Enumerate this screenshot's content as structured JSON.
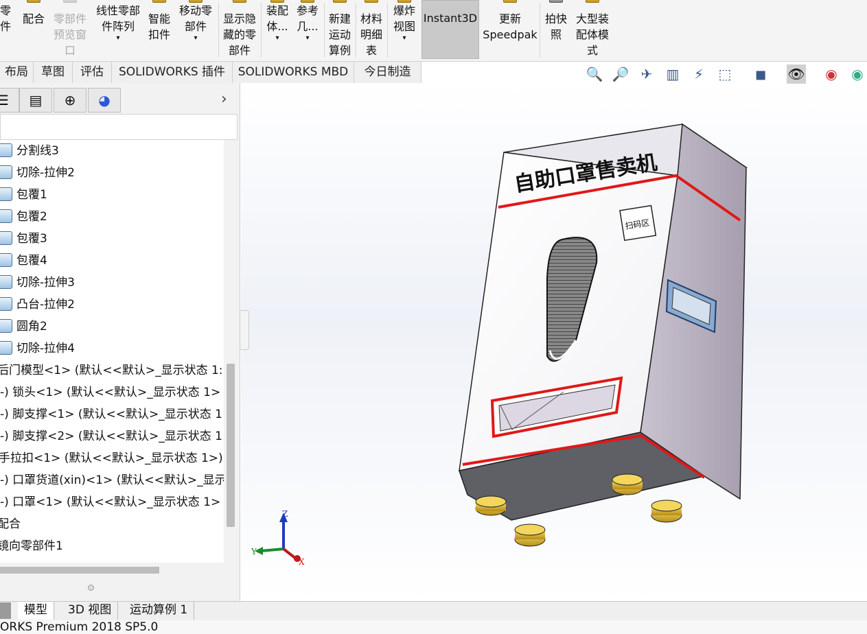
{
  "ribbon": {
    "items": [
      {
        "label": "零\n件",
        "disabled": false
      },
      {
        "label": "配合",
        "disabled": false
      },
      {
        "label": "零部件\n预览窗\n口",
        "disabled": true
      },
      {
        "label": "线性零部\n件阵列",
        "disabled": false
      },
      {
        "label": "智能\n扣件",
        "disabled": false
      },
      {
        "label": "移动零\n部件",
        "disabled": false
      },
      {
        "label": "显示隐\n藏的零\n部件",
        "disabled": false
      },
      {
        "label": "装配\n体...",
        "disabled": false
      },
      {
        "label": "参考\n几...",
        "disabled": false
      },
      {
        "label": "新建\n运动\n算例",
        "disabled": false
      },
      {
        "label": "材料\n明细\n表",
        "disabled": false
      },
      {
        "label": "爆炸\n视图",
        "disabled": false
      },
      {
        "label": "Instant3D",
        "disabled": false
      },
      {
        "label": "更新\nSpeedpak",
        "disabled": false
      },
      {
        "label": "拍快\n照",
        "disabled": false
      },
      {
        "label": "大型装\n配体模\n式",
        "disabled": false
      }
    ]
  },
  "tabs": [
    "布局",
    "草图",
    "评估",
    "SOLIDWORKS 插件",
    "SOLIDWORKS MBD",
    "今日制造"
  ],
  "panel": {
    "tree": [
      "分割线3",
      "切除-拉伸2",
      "包覆1",
      "包覆2",
      "包覆3",
      "包覆4",
      "切除-拉伸3",
      "凸台-拉伸2",
      "圆角2",
      "切除-拉伸4",
      "后门模型<1> (默认<<默认>_显示状态 1:",
      "-) 锁头<1> (默认<<默认>_显示状态 1>",
      "-) 脚支撑<1> (默认<<默认>_显示状态 1",
      "-) 脚支撑<2> (默认<<默认>_显示状态 1",
      "手拉扣<1> (默认<<默认>_显示状态 1>)",
      "-) 口罩货道(xin)<1> (默认<<默认>_显示",
      "-) 口罩<1> (默认<<默认>_显示状态 1>",
      "配合",
      "镜向零部件1"
    ]
  },
  "model": {
    "title": "自助口罩售卖机",
    "qr_label": "扫码区"
  },
  "triad": {
    "x": "X",
    "y": "Y",
    "z": "Z"
  },
  "bottom_tabs": [
    "模型",
    "3D 视图",
    "运动算例 1"
  ],
  "status": "ORKS Premium 2018 SP5.0",
  "colors": {
    "accent_red": "#e01818",
    "selected_tab": "#c9c9c9"
  }
}
